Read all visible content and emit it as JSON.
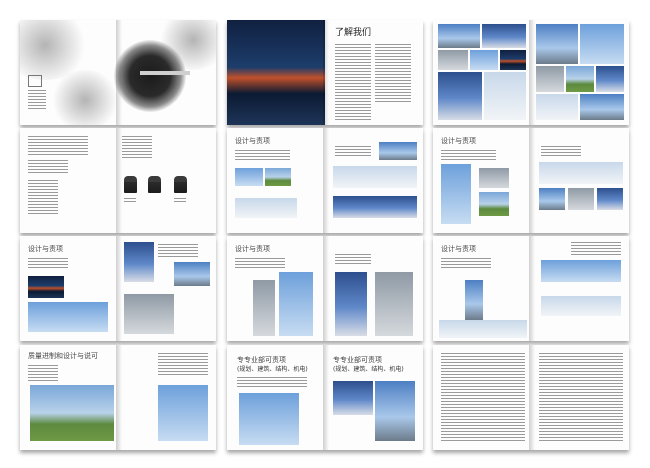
{
  "spreads": [
    {
      "id": "cover",
      "headline": ""
    },
    {
      "id": "about",
      "title": "了解我们"
    },
    {
      "id": "gallery-1"
    },
    {
      "id": "team"
    },
    {
      "id": "design-1",
      "title_left": "设计与责项"
    },
    {
      "id": "design-2",
      "title_left": "设计与责项"
    },
    {
      "id": "design-3",
      "title_left": "设计与责项"
    },
    {
      "id": "design-4",
      "title_left": "设计与责项"
    },
    {
      "id": "design-5",
      "title_left": "设计与责项"
    },
    {
      "id": "planning",
      "title": "质量进制和设计与说可"
    },
    {
      "id": "professional",
      "title_left": "专专业部可责项",
      "subtitle_left": "(规划、建筑、结构、机电)",
      "title_right": "专专业部可责项",
      "subtitle_right": "(规划、建筑、结构、机电)"
    },
    {
      "id": "text-1"
    },
    {
      "id": "text-2"
    }
  ]
}
